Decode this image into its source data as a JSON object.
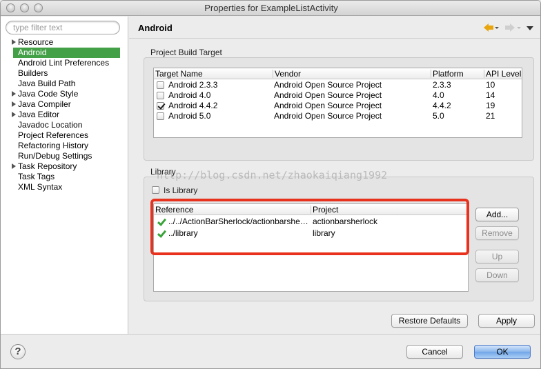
{
  "window": {
    "title": "Properties for ExampleListActivity"
  },
  "sidebar": {
    "filter_placeholder": "type filter text",
    "items": [
      {
        "label": "Resource",
        "expandable": true
      },
      {
        "label": "Android",
        "selected": true
      },
      {
        "label": "Android Lint Preferences"
      },
      {
        "label": "Builders"
      },
      {
        "label": "Java Build Path"
      },
      {
        "label": "Java Code Style",
        "expandable": true
      },
      {
        "label": "Java Compiler",
        "expandable": true
      },
      {
        "label": "Java Editor",
        "expandable": true
      },
      {
        "label": "Javadoc Location"
      },
      {
        "label": "Project References"
      },
      {
        "label": "Refactoring History"
      },
      {
        "label": "Run/Debug Settings"
      },
      {
        "label": "Task Repository",
        "expandable": true
      },
      {
        "label": "Task Tags"
      },
      {
        "label": "XML Syntax"
      }
    ]
  },
  "page": {
    "title": "Android"
  },
  "build_target": {
    "group_label": "Project Build Target",
    "columns": [
      "Target Name",
      "Vendor",
      "Platform",
      "API Level"
    ],
    "rows": [
      {
        "name": "Android 2.3.3",
        "vendor": "Android Open Source Project",
        "platform": "2.3.3",
        "api": "10",
        "checked": false
      },
      {
        "name": "Android 4.0",
        "vendor": "Android Open Source Project",
        "platform": "4.0",
        "api": "14",
        "checked": false
      },
      {
        "name": "Android 4.4.2",
        "vendor": "Android Open Source Project",
        "platform": "4.4.2",
        "api": "19",
        "checked": true
      },
      {
        "name": "Android 5.0",
        "vendor": "Android Open Source Project",
        "platform": "5.0",
        "api": "21",
        "checked": false
      }
    ]
  },
  "library": {
    "group_label": "Library",
    "is_library_label": "Is Library",
    "is_library_checked": false,
    "watermark": "http://blog.csdn.net/zhaokaiqiang1992",
    "columns": [
      "Reference",
      "Project"
    ],
    "rows": [
      {
        "reference": "../../ActionBarSherlock/actionbarsherlock",
        "project": "actionbarsherlock"
      },
      {
        "reference": "../library",
        "project": "library"
      }
    ],
    "buttons": {
      "add": "Add...",
      "remove": "Remove",
      "up": "Up",
      "down": "Down"
    }
  },
  "actions": {
    "restore_defaults": "Restore Defaults",
    "apply": "Apply",
    "cancel": "Cancel",
    "ok": "OK",
    "help": "?"
  },
  "colors": {
    "selection": "#43a047",
    "highlight": "#e8321d",
    "check": "#3aa33a",
    "nav_back": "#e8a50d"
  }
}
